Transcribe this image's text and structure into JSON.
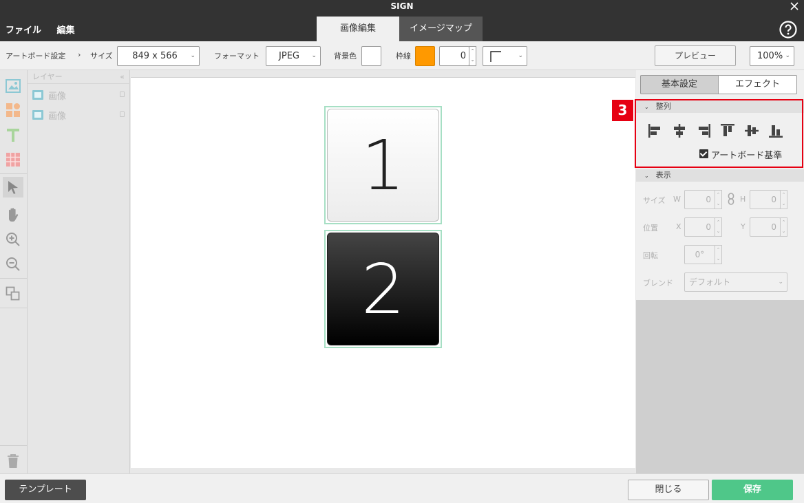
{
  "window": {
    "title": "SIGN"
  },
  "menu": {
    "file": "ファイル",
    "edit": "編集"
  },
  "tabs": [
    {
      "label": "画像編集",
      "active": true
    },
    {
      "label": "イメージマップ",
      "active": false
    }
  ],
  "toolbar": {
    "artboard_label": "アートボード設定",
    "size_label": "サイズ",
    "size_value": "849 x 566",
    "format_label": "フォーマット",
    "format_value": "JPEG",
    "bgcolor_label": "背景色",
    "bgcolor": "#ffffff",
    "border_label": "枠線",
    "border_color": "#ff9900",
    "border_width": "0",
    "preview_label": "プレビュー",
    "zoom": "100%"
  },
  "layers": {
    "header": "レイヤー",
    "collapse": "«",
    "items": [
      {
        "name": "画像"
      },
      {
        "name": "画像"
      }
    ]
  },
  "canvas": {
    "tiles": [
      {
        "label": "1"
      },
      {
        "label": "2"
      }
    ]
  },
  "panel": {
    "tab_basic": "基本設定",
    "tab_effect": "エフェクト",
    "align_section": "整列",
    "align_buttons": [
      "align-left",
      "align-center-h",
      "align-right",
      "align-top",
      "align-middle-v",
      "align-bottom"
    ],
    "artboard_basis": "アートボード基準",
    "artboard_basis_checked": true,
    "display_section": "表示",
    "size_label": "サイズ",
    "w_label": "W",
    "h_label": "H",
    "w_value": "0",
    "h_value": "0",
    "position_label": "位置",
    "x_label": "X",
    "y_label": "Y",
    "x_value": "0",
    "y_value": "0",
    "rotate_label": "回転",
    "rotate_value": "0°",
    "blend_label": "ブレンド",
    "blend_value": "デフォルト"
  },
  "callout": {
    "number": "3",
    "color": "#e60012"
  },
  "footer": {
    "template": "テンプレート",
    "close": "閉じる",
    "save": "保存"
  }
}
